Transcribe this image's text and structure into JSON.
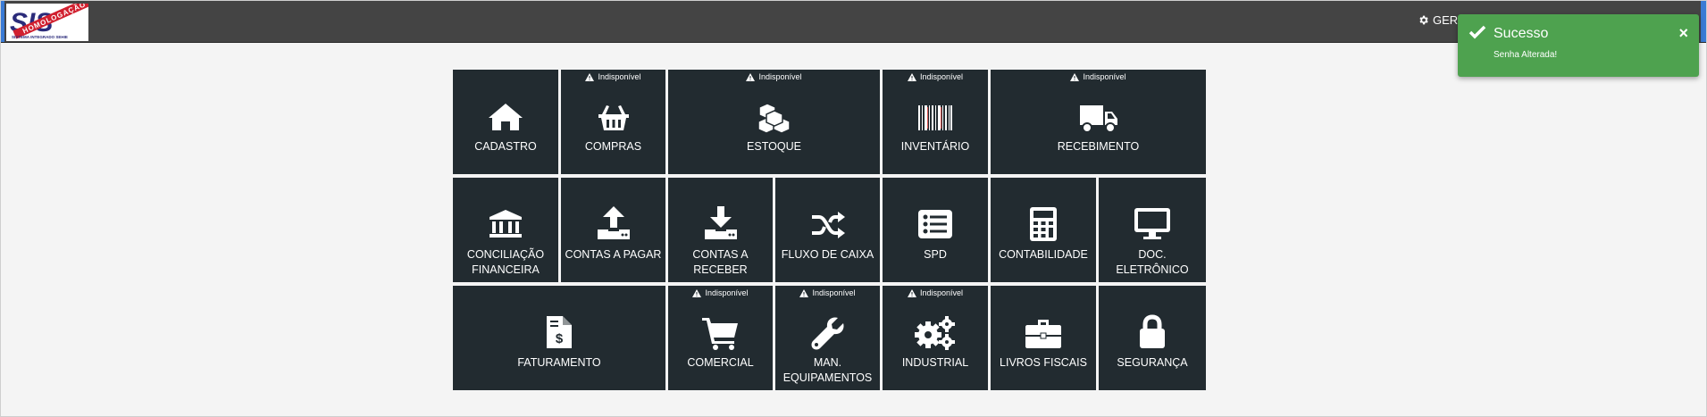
{
  "header": {
    "logo_text": "SIS",
    "logo_ribbon": "HOMOLOGAÇÃO",
    "logo_sub": "SISTEMA INTEGRADO SEHIE",
    "user_menu_label": "GERE"
  },
  "toast": {
    "title": "Sucesso",
    "message": "Senha Alterada!",
    "close": "×",
    "color": "#4ea24f"
  },
  "unavailable_label": "Indisponível",
  "tiles": {
    "cadastro": {
      "line1": "CADASTRO",
      "line2": "",
      "icon": "home-icon"
    },
    "compras": {
      "line1": "COMPRAS",
      "line2": "",
      "icon": "basket-icon",
      "unavailable": true
    },
    "estoque": {
      "line1": "ESTOQUE",
      "line2": "",
      "icon": "cubes-icon",
      "unavailable": true
    },
    "inventario": {
      "line1": "INVENTÁRIO",
      "line2": "",
      "icon": "barcode-icon",
      "unavailable": true
    },
    "recebimento": {
      "line1": "RECEBIMENTO",
      "line2": "",
      "icon": "truck-icon",
      "unavailable": true
    },
    "conciliacao": {
      "line1": "CONCILIAÇÃO",
      "line2": "FINANCEIRA",
      "icon": "bank-icon"
    },
    "contas_pagar": {
      "line1": "CONTAS A PAGAR",
      "line2": "",
      "icon": "upload-icon"
    },
    "contas_receber": {
      "line1": "CONTAS A",
      "line2": "RECEBER",
      "icon": "download-icon"
    },
    "fluxo_caixa": {
      "line1": "FLUXO DE CAIXA",
      "line2": "",
      "icon": "shuffle-icon"
    },
    "spd": {
      "line1": "SPD",
      "line2": "",
      "icon": "list-icon"
    },
    "contabilidade": {
      "line1": "CONTABILIDADE",
      "line2": "",
      "icon": "calculator-icon"
    },
    "doc_eletronico": {
      "line1": "DOC.",
      "line2": "ELETRÔNICO",
      "icon": "monitor-icon"
    },
    "faturamento": {
      "line1": "FATURAMENTO",
      "line2": "",
      "icon": "invoice-icon"
    },
    "comercial": {
      "line1": "COMERCIAL",
      "line2": "",
      "icon": "cart-icon",
      "unavailable": true
    },
    "man_equipamentos": {
      "line1": "MAN.",
      "line2": "EQUIPAMENTOS",
      "icon": "wrench-icon",
      "unavailable": true
    },
    "industrial": {
      "line1": "INDUSTRIAL",
      "line2": "",
      "icon": "gears-icon",
      "unavailable": true
    },
    "livros_fiscais": {
      "line1": "LIVROS FISCAIS",
      "line2": "",
      "icon": "briefcase-icon"
    },
    "seguranca": {
      "line1": "SEGURANÇA",
      "line2": "",
      "icon": "lock-icon"
    }
  }
}
